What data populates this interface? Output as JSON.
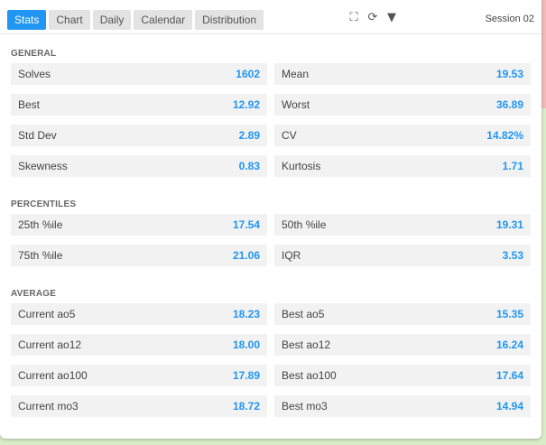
{
  "tabs": [
    {
      "label": "Stats"
    },
    {
      "label": "Chart"
    },
    {
      "label": "Daily"
    },
    {
      "label": "Calendar"
    },
    {
      "label": "Distribution"
    }
  ],
  "session": "Session 02",
  "sections": {
    "general": {
      "title": "GENERAL",
      "rows": [
        [
          {
            "label": "Solves",
            "value": "1602"
          },
          {
            "label": "Mean",
            "value": "19.53"
          }
        ],
        [
          {
            "label": "Best",
            "value": "12.92"
          },
          {
            "label": "Worst",
            "value": "36.89"
          }
        ],
        [
          {
            "label": "Std Dev",
            "value": "2.89"
          },
          {
            "label": "CV",
            "value": "14.82%"
          }
        ],
        [
          {
            "label": "Skewness",
            "value": "0.83"
          },
          {
            "label": "Kurtosis",
            "value": "1.71"
          }
        ]
      ]
    },
    "percentiles": {
      "title": "PERCENTILES",
      "rows": [
        [
          {
            "label": "25th %ile",
            "value": "17.54"
          },
          {
            "label": "50th %ile",
            "value": "19.31"
          }
        ],
        [
          {
            "label": "75th %ile",
            "value": "21.06"
          },
          {
            "label": "IQR",
            "value": "3.53"
          }
        ]
      ]
    },
    "average": {
      "title": "AVERAGE",
      "rows": [
        [
          {
            "label": "Current ao5",
            "value": "18.23"
          },
          {
            "label": "Best ao5",
            "value": "15.35"
          }
        ],
        [
          {
            "label": "Current ao12",
            "value": "18.00"
          },
          {
            "label": "Best ao12",
            "value": "16.24"
          }
        ],
        [
          {
            "label": "Current ao100",
            "value": "17.89"
          },
          {
            "label": "Best ao100",
            "value": "17.64"
          }
        ],
        [
          {
            "label": "Current mo3",
            "value": "18.72"
          },
          {
            "label": "Best mo3",
            "value": "14.94"
          }
        ]
      ]
    }
  },
  "icons": [
    "fullscreen-icon",
    "refresh-icon",
    "dropdown-icon"
  ],
  "colors": {
    "accent": "#2196f3",
    "cell_bg": "#f2f2f2",
    "page_bg": "#d8ecc8"
  }
}
